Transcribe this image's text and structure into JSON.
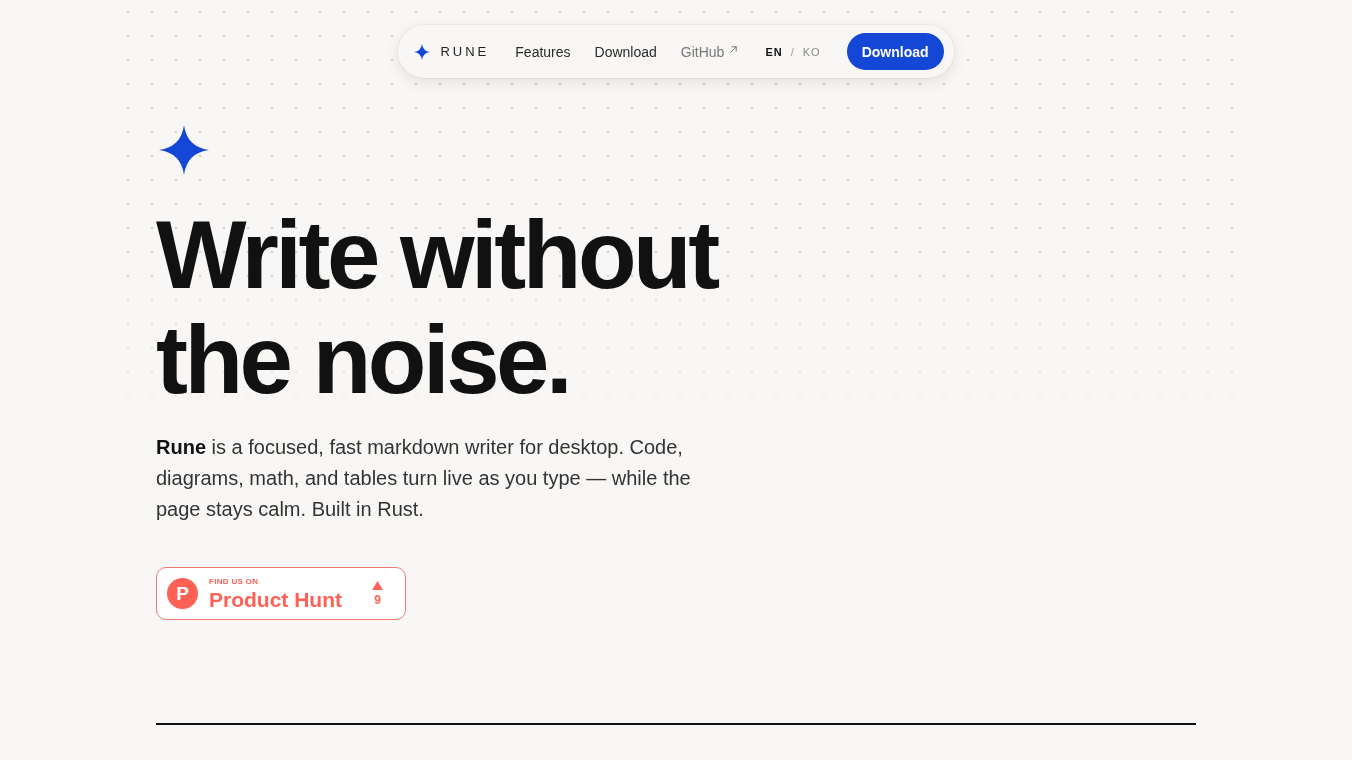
{
  "nav": {
    "logo": "RUNE",
    "links": [
      {
        "label": "Features",
        "external": false
      },
      {
        "label": "Download",
        "external": false
      },
      {
        "label": "GitHub",
        "external": true
      }
    ],
    "languages": [
      {
        "label": "EN",
        "selected": true
      },
      {
        "label": "KO",
        "selected": false
      }
    ],
    "language_separator": "/",
    "button": "Download"
  },
  "hero": {
    "title_lines": [
      "Write without",
      "the noise."
    ],
    "description": "**Rune** is a focused, fast markdown writer for desktop. Code, diagrams, math, and tables turn live as you type — while the page stays calm. Built in Rust.",
    "badge": {
      "logo_letter": "P",
      "eyebrow": "FIND US ON",
      "name": "Product Hunt",
      "upvotes": "9"
    }
  }
}
